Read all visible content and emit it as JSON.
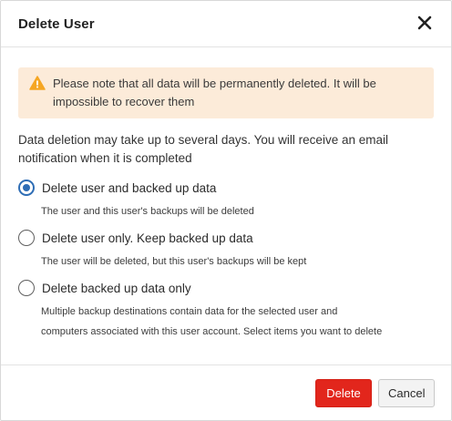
{
  "dialog": {
    "title": "Delete User",
    "close_icon": "close-icon"
  },
  "alert": {
    "icon": "warning-triangle-icon",
    "color": "#f5a623",
    "background": "#fcebd9",
    "line1": "Please note that all data will be permanently deleted. It will be",
    "line2": "impossible to recover them"
  },
  "description": {
    "line1": "Data deletion may take up to several days. You will receive an email",
    "line2": "notification when it is completed"
  },
  "options": [
    {
      "label": "Delete user and backed up data",
      "note_lines": [
        "The user and this user's backups will be deleted"
      ],
      "selected": true
    },
    {
      "label": "Delete user only. Keep backed up data",
      "note_lines": [
        "The user will be deleted, but this user's backups will be kept"
      ],
      "selected": false
    },
    {
      "label": "Delete backed up data only",
      "note_lines": [
        "Multiple backup destinations contain data for the selected user and",
        "computers associated with this user account. Select items you want to delete"
      ],
      "selected": false
    }
  ],
  "footer": {
    "delete_label": "Delete",
    "cancel_label": "Cancel",
    "delete_color": "#e2261c"
  },
  "accent_color": "#2e6db5"
}
